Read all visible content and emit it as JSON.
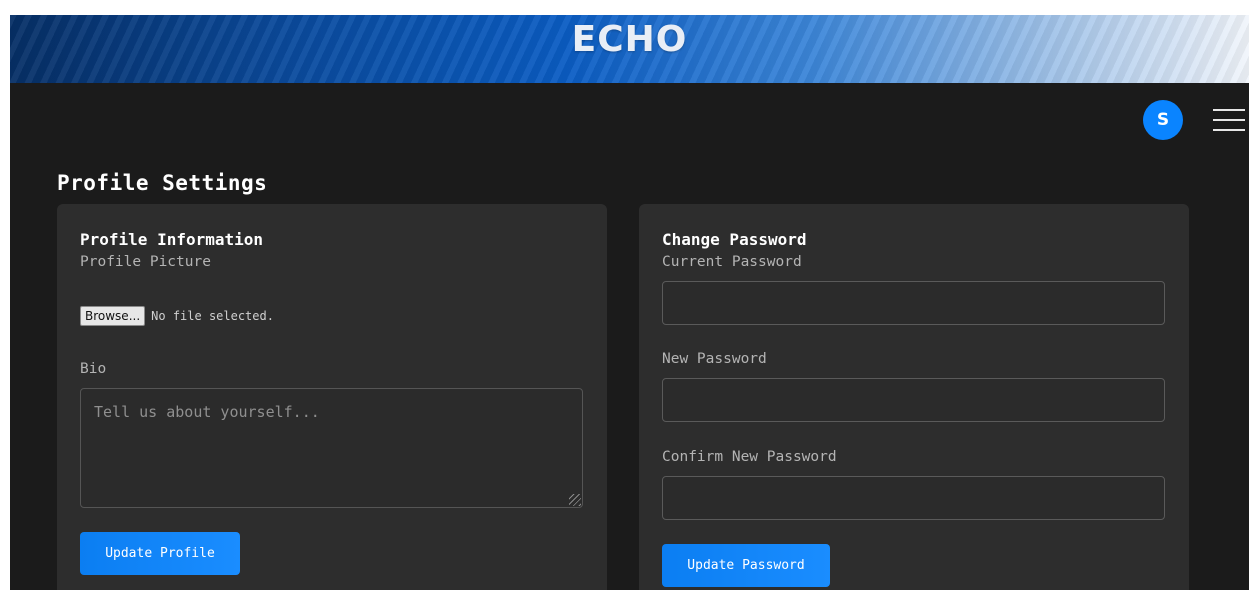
{
  "header": {
    "brand": "ECHO"
  },
  "user": {
    "avatar_initial": "S"
  },
  "icons": {
    "menu": "hamburger-menu-icon",
    "resize": "resize-grip-icon"
  },
  "colors": {
    "accent": "#0a84ff",
    "background": "#1b1b1b",
    "card": "#2d2d2d"
  },
  "page": {
    "title": "Profile Settings"
  },
  "profile_card": {
    "title": "Profile Information",
    "picture_label": "Profile Picture",
    "browse_label": "Browse...",
    "file_status": "No file selected.",
    "bio_label": "Bio",
    "bio_placeholder": "Tell us about yourself...",
    "bio_value": "",
    "submit_label": "Update Profile"
  },
  "password_card": {
    "title": "Change Password",
    "current_label": "Current Password",
    "current_value": "",
    "new_label": "New Password",
    "new_value": "",
    "confirm_label": "Confirm New Password",
    "confirm_value": "",
    "submit_label": "Update Password"
  }
}
